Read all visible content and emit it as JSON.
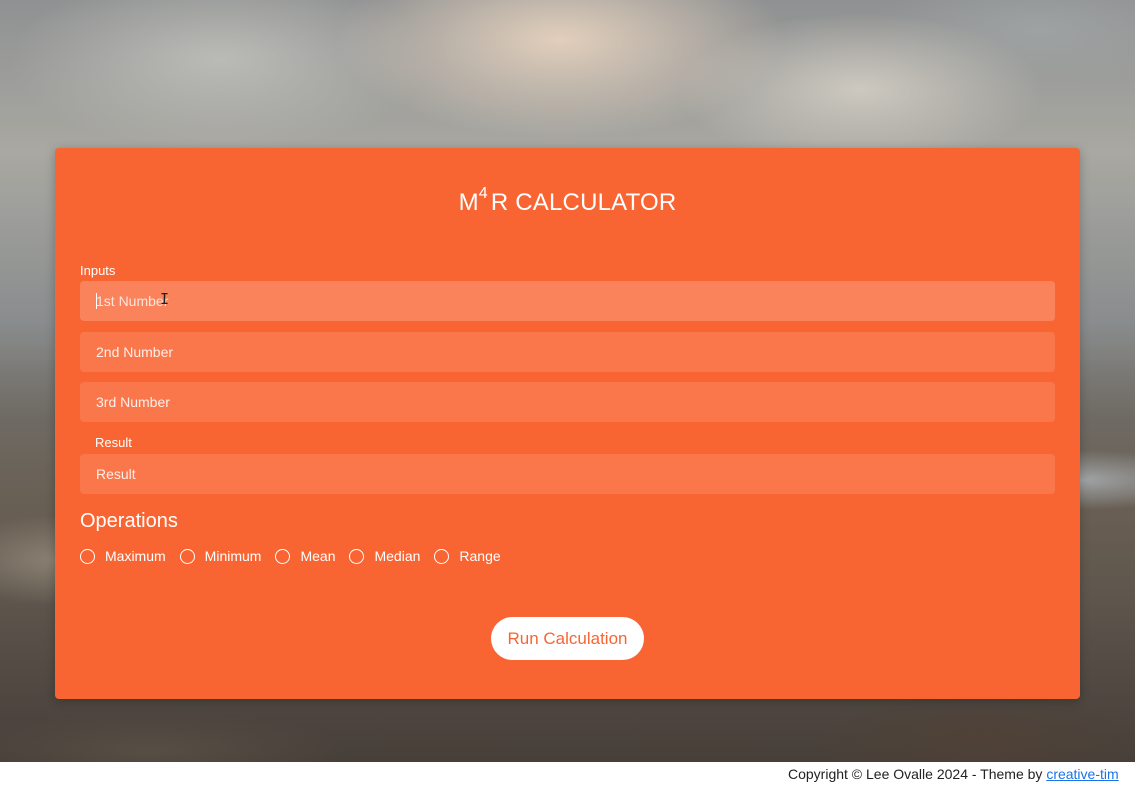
{
  "app": {
    "title_main": "M",
    "title_sup": "4",
    "title_rest": "R CALCULATOR"
  },
  "inputs": {
    "section_label": "Inputs",
    "first": {
      "placeholder": "1st Number",
      "value": ""
    },
    "second": {
      "placeholder": "2nd Number",
      "value": ""
    },
    "third": {
      "placeholder": "3rd Number",
      "value": ""
    }
  },
  "result": {
    "label": "Result",
    "placeholder": "Result",
    "value": ""
  },
  "operations": {
    "title": "Operations",
    "options": [
      {
        "label": "Maximum",
        "selected": false
      },
      {
        "label": "Minimum",
        "selected": false
      },
      {
        "label": "Mean",
        "selected": false
      },
      {
        "label": "Median",
        "selected": false
      },
      {
        "label": "Range",
        "selected": false
      }
    ]
  },
  "actions": {
    "run_label": "Run Calculation"
  },
  "footer": {
    "copyright": "Copyright © Lee Ovalle 2024 - Theme by ",
    "link_text": "creative-tim"
  },
  "colors": {
    "card": "#f96532",
    "button_text": "#f96532",
    "link": "#1a73e8"
  }
}
